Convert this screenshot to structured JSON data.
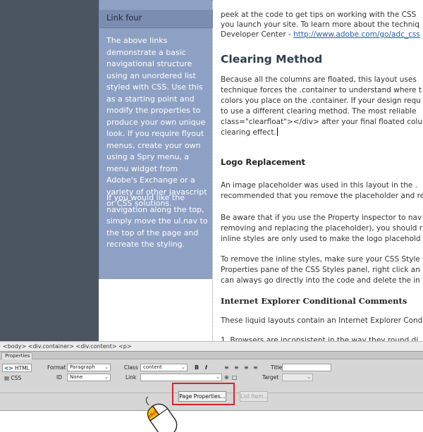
{
  "sidebar": {
    "nav_link": "Link four",
    "paragraph1": "The above links demonstrate a basic navigational structure using an unordered list styled with CSS. Use this as a starting point and modify the properties to produce your own unique look. If you require flyout menus, create your own using a Spry menu, a menu widget from Adobe's Exchange or a variety of other javascript or CSS solutions.",
    "paragraph2": "If you would like the navigation along the top, simply move the ul.nav to the top of the page and recreate the styling."
  },
  "content": {
    "intro_line1": "peek at the code to get tips on working with the CSS",
    "intro_line2": "you launch your site. To learn more about the techniq",
    "intro_line3_text": "Developer Center - ",
    "intro_line3_link": "http://www.adobe.com/go/adc_css",
    "clearing_heading": "Clearing Method",
    "clearing_lines": [
      "Because all the columns are floated, this layout uses",
      "technique forces the .container to understand where t",
      "colors you place on the .container. If your design requ",
      "to use a different clearing method. The most reliable",
      "class=\"clearfloat\"></div> after your final floated colu",
      "clearing effect."
    ],
    "logo_heading": "Logo Replacement",
    "logo_lines": [
      "An image placeholder was used in this layout in the .",
      "recommended that you remove the placeholder and re"
    ],
    "aware_lines": [
      "Be aware that if you use the Property inspector to nav",
      "removing and replacing the placeholder), you should r",
      "inline styles are only used to make the logo placehold"
    ],
    "remove_lines": [
      "To remove the inline styles, make sure your CSS Style",
      "Properties pane of the CSS Styles panel, right click an",
      "can always go directly into the code and delete the in"
    ],
    "ie_heading": "Internet Explorer Conditional Comments",
    "ie_line": "These liquid layouts contain an Internet Explorer Cond",
    "list_line": "1.   Browsers are inconsistent in the way they round di"
  },
  "tag_selector": "<body> <div.container> <div.content> <p>",
  "properties": {
    "tab_label": "Properties",
    "html_button": "HTML",
    "css_button": "CSS",
    "format_label": "Format",
    "format_value": "Paragraph",
    "id_label": "ID",
    "id_value": "None",
    "class_label": "Class",
    "class_value": "content",
    "link_label": "Link",
    "link_value": "",
    "bold_glyph": "B",
    "italic_glyph": "I",
    "title_label": "Title",
    "title_value": "",
    "target_label": "Target",
    "page_properties_button": "Page Properties...",
    "list_item_button": "List Item..."
  },
  "colors": {
    "sidebar_bg": "#8ea1c4",
    "left_strip": "#4a5560",
    "highlight_box": "#d8232a",
    "mouse_click": "#f2c200",
    "click_label": "#d8232a"
  },
  "mouse": {
    "click_label": "click"
  }
}
